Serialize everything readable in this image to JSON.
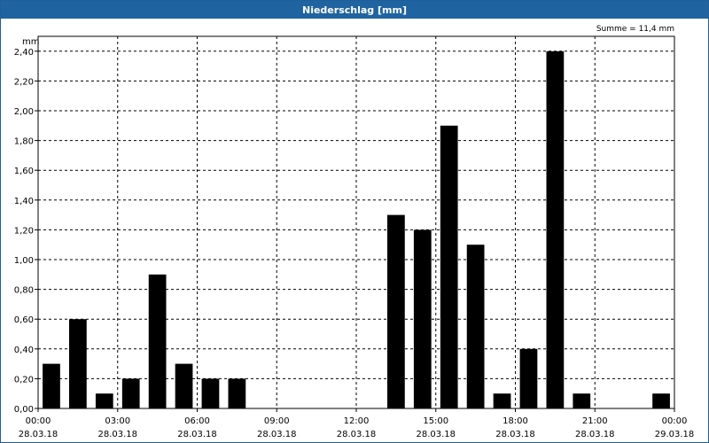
{
  "window": {
    "title": "Niederschlag [mm]"
  },
  "colors": {
    "titlebar": "#1f64a0",
    "bars": "#000000",
    "grid": "#000000"
  },
  "chart_data": {
    "type": "bar",
    "title": "Niederschlag [mm]",
    "ylabel": "mm",
    "summary": "Summe = 11,4 mm",
    "ylim": [
      0,
      2.5
    ],
    "yticks": [
      0,
      0.2,
      0.4,
      0.6,
      0.8,
      1.0,
      1.2,
      1.4,
      1.6,
      1.8,
      2.0,
      2.2,
      2.4
    ],
    "ytick_labels": [
      "0,00",
      "0,20",
      "0,40",
      "0,60",
      "0,80",
      "1,00",
      "1,20",
      "1,40",
      "1,60",
      "1,80",
      "2,00",
      "2,20",
      "2,40"
    ],
    "xlim_hours": [
      0,
      24
    ],
    "xticks": [
      {
        "hour": 0,
        "time": "00:00",
        "date": "28.03.18"
      },
      {
        "hour": 3,
        "time": "03:00",
        "date": "28.03.18"
      },
      {
        "hour": 6,
        "time": "06:00",
        "date": "28.03.18"
      },
      {
        "hour": 9,
        "time": "09:00",
        "date": "28.03.18"
      },
      {
        "hour": 12,
        "time": "12:00",
        "date": "28.03.18"
      },
      {
        "hour": 15,
        "time": "15:00",
        "date": "28.03.18"
      },
      {
        "hour": 18,
        "time": "18:00",
        "date": "28.03.18"
      },
      {
        "hour": 21,
        "time": "21:00",
        "date": "28.03.18"
      },
      {
        "hour": 24,
        "time": "00:00",
        "date": "29.03.18"
      }
    ],
    "bar_hours": [
      0,
      1,
      2,
      3,
      4,
      5,
      6,
      7,
      8,
      9,
      10,
      11,
      12,
      13,
      14,
      15,
      16,
      17,
      18,
      19,
      20,
      21,
      22,
      23
    ],
    "values": [
      0.3,
      0.6,
      0.1,
      0.2,
      0.9,
      0.3,
      0.2,
      0.2,
      0,
      0,
      0,
      0,
      0,
      1.3,
      1.2,
      1.9,
      1.1,
      0.1,
      0.4,
      2.4,
      0.1,
      0,
      0,
      0.1
    ],
    "grid": true,
    "legend": "none"
  }
}
